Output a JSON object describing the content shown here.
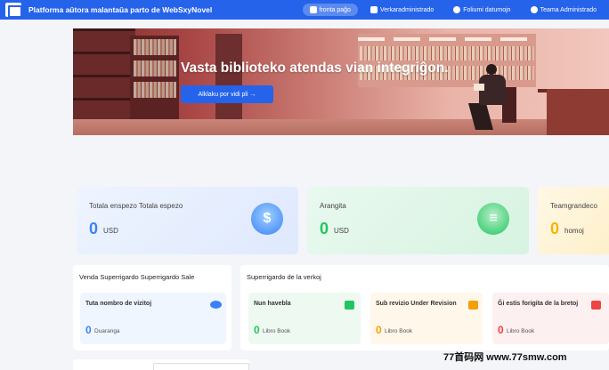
{
  "header": {
    "brand": "Platforma aŭtora malantaŭa parto de WebSxyNovel",
    "nav": [
      {
        "label": "fronta paĝo",
        "icon": "home-icon",
        "active": true
      },
      {
        "label": "Verkaradministrado",
        "icon": "book-icon",
        "active": false
      },
      {
        "label": "Foliumi datumojn",
        "icon": "chart-icon",
        "active": false
      },
      {
        "label": "Teama Administrado",
        "icon": "team-icon",
        "active": false
      }
    ]
  },
  "banner": {
    "title": "Vasta biblioteko atendas vian integriĝon.",
    "button_label": "Alklaku por vidi pli →"
  },
  "stats": {
    "expense": {
      "label": "Totala enspezo Totala espezo",
      "value": "0",
      "unit": "USD",
      "icon": "money-icon"
    },
    "subsidy": {
      "label": "Arangita",
      "value": "0",
      "unit": "USD",
      "icon": "coins-icon"
    },
    "team": {
      "label": "Teamgrandeco",
      "value": "0",
      "unit": "homoj"
    }
  },
  "sales_panel": {
    "title": "Venda Superrigardo Superrigardo Sale",
    "visit_title": "Tuta nombro de vizitoj",
    "visit_value": "0",
    "visit_unit": "Duaranga",
    "visit_icon": "eye-icon"
  },
  "works_panel": {
    "title": "Superrigardo de la verkoj",
    "items": [
      {
        "title": "Nun havebla",
        "value": "0",
        "unit": "Libro Book",
        "icon": "book-available-icon",
        "color": "#22c55e"
      },
      {
        "title": "Sub revizio Under Revision",
        "value": "0",
        "unit": "Libro Book",
        "icon": "review-icon",
        "color": "#f59e0b"
      },
      {
        "title": "Ĝi estis forigita de la bretoj",
        "value": "0",
        "unit": "Libro Book",
        "icon": "removed-icon",
        "color": "#ef4444"
      }
    ]
  },
  "colors": {
    "primary": "#2563eb",
    "blue_value": "#3b82f6",
    "green_value": "#22c55e",
    "yellow_value": "#f5b301"
  },
  "watermark": "77首码网 www.77smw.com"
}
